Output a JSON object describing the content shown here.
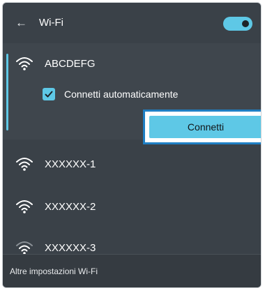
{
  "header": {
    "back_icon": "←",
    "title": "Wi-Fi",
    "toggle_state": "on"
  },
  "networks": [
    {
      "name": "ABCDEFG",
      "expanded": true,
      "signal": "strong"
    },
    {
      "name": "XXXXXX-1",
      "signal": "strong"
    },
    {
      "name": "XXXXXX-2",
      "signal": "strong"
    },
    {
      "name": "XXXXXX-3",
      "signal": "weak"
    }
  ],
  "expanded_network": {
    "auto_connect_label": "Connetti automaticamente",
    "auto_connect_checked": true,
    "connect_label": "Connetti"
  },
  "footer": {
    "more_settings_label": "Altre impostazioni Wi-Fi"
  },
  "colors": {
    "accent": "#5ec8e6",
    "panel_bg": "#3a4148",
    "highlight_border": "#1f7fc4"
  }
}
